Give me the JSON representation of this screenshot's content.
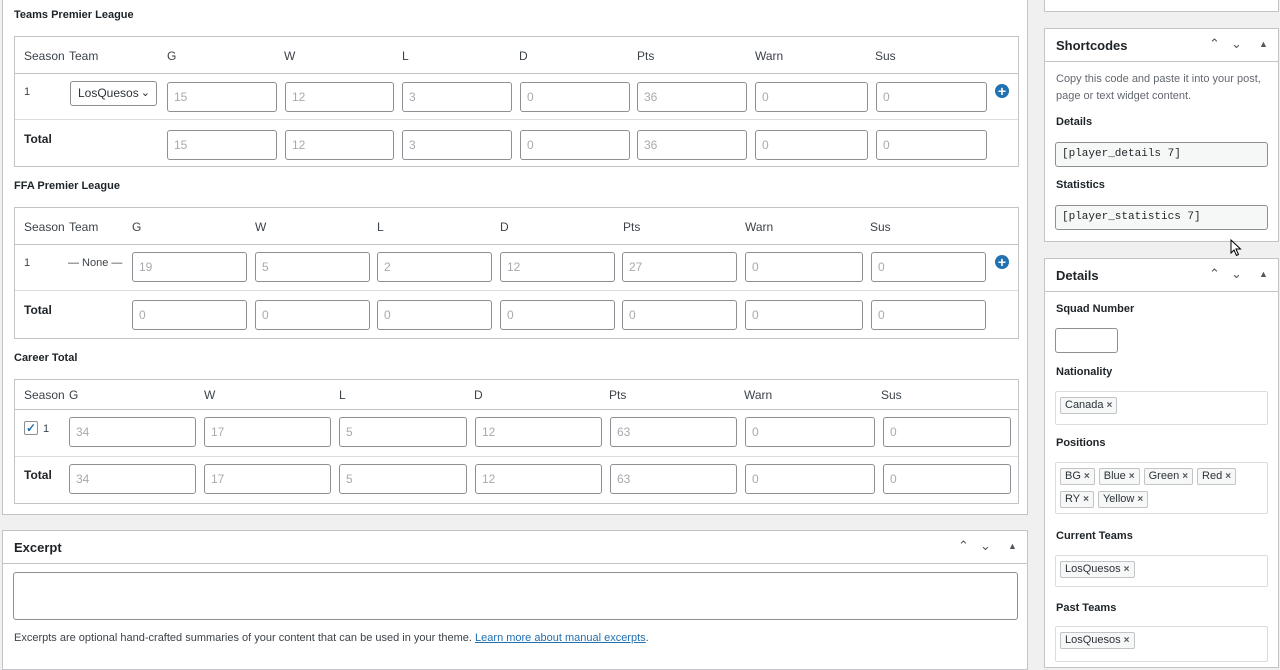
{
  "teams_league": {
    "title": "Teams Premier League",
    "headers": [
      "Season",
      "Team",
      "G",
      "W",
      "L",
      "D",
      "Pts",
      "Warn",
      "Sus"
    ],
    "row": {
      "season": "1",
      "team": "LosQuesos",
      "values": [
        "15",
        "12",
        "3",
        "0",
        "36",
        "0",
        "0"
      ]
    },
    "total": {
      "label": "Total",
      "values": [
        "15",
        "12",
        "3",
        "0",
        "36",
        "0",
        "0"
      ]
    }
  },
  "ffa_league": {
    "title": "FFA Premier League",
    "headers": [
      "Season",
      "Team",
      "G",
      "W",
      "L",
      "D",
      "Pts",
      "Warn",
      "Sus"
    ],
    "row": {
      "season": "1",
      "team": "— None —",
      "values": [
        "19",
        "5",
        "2",
        "12",
        "27",
        "0",
        "0"
      ]
    },
    "total": {
      "label": "Total",
      "values": [
        "0",
        "0",
        "0",
        "0",
        "0",
        "0",
        "0"
      ]
    }
  },
  "career": {
    "title": "Career Total",
    "headers": [
      "Season",
      "G",
      "W",
      "L",
      "D",
      "Pts",
      "Warn",
      "Sus"
    ],
    "row": {
      "season": "1",
      "checked": true,
      "values": [
        "34",
        "17",
        "5",
        "12",
        "63",
        "0",
        "0"
      ]
    },
    "total": {
      "label": "Total",
      "values": [
        "34",
        "17",
        "5",
        "12",
        "63",
        "0",
        "0"
      ]
    }
  },
  "excerpt": {
    "title": "Excerpt",
    "help_text": "Excerpts are optional hand-crafted summaries of your content that can be used in your theme.",
    "help_link": "Learn more about manual excerpts",
    "help_end": "."
  },
  "shortcodes": {
    "title": "Shortcodes",
    "help": "Copy this code and paste it into your post, page or text widget content.",
    "details_label": "Details",
    "details_code": "[player_details 7]",
    "statistics_label": "Statistics",
    "statistics_code": "[player_statistics 7]"
  },
  "details": {
    "title": "Details",
    "squad_label": "Squad Number",
    "nationality_label": "Nationality",
    "nationality": [
      "Canada"
    ],
    "positions_label": "Positions",
    "positions": [
      "BG",
      "Blue",
      "Green",
      "Red",
      "RY",
      "Yellow"
    ],
    "current_teams_label": "Current Teams",
    "current_teams": [
      "LosQuesos"
    ],
    "past_teams_label": "Past Teams",
    "past_teams": [
      "LosQuesos"
    ]
  },
  "icons": {
    "remove": "×",
    "up": "⌃",
    "down": "⌄",
    "toggle": "▲",
    "add": "+",
    "select_chevron": "⌄",
    "check": "✓"
  },
  "colors": {
    "accent": "#2271b1",
    "border": "#c3c4c7",
    "background": "#f0f0f1"
  }
}
